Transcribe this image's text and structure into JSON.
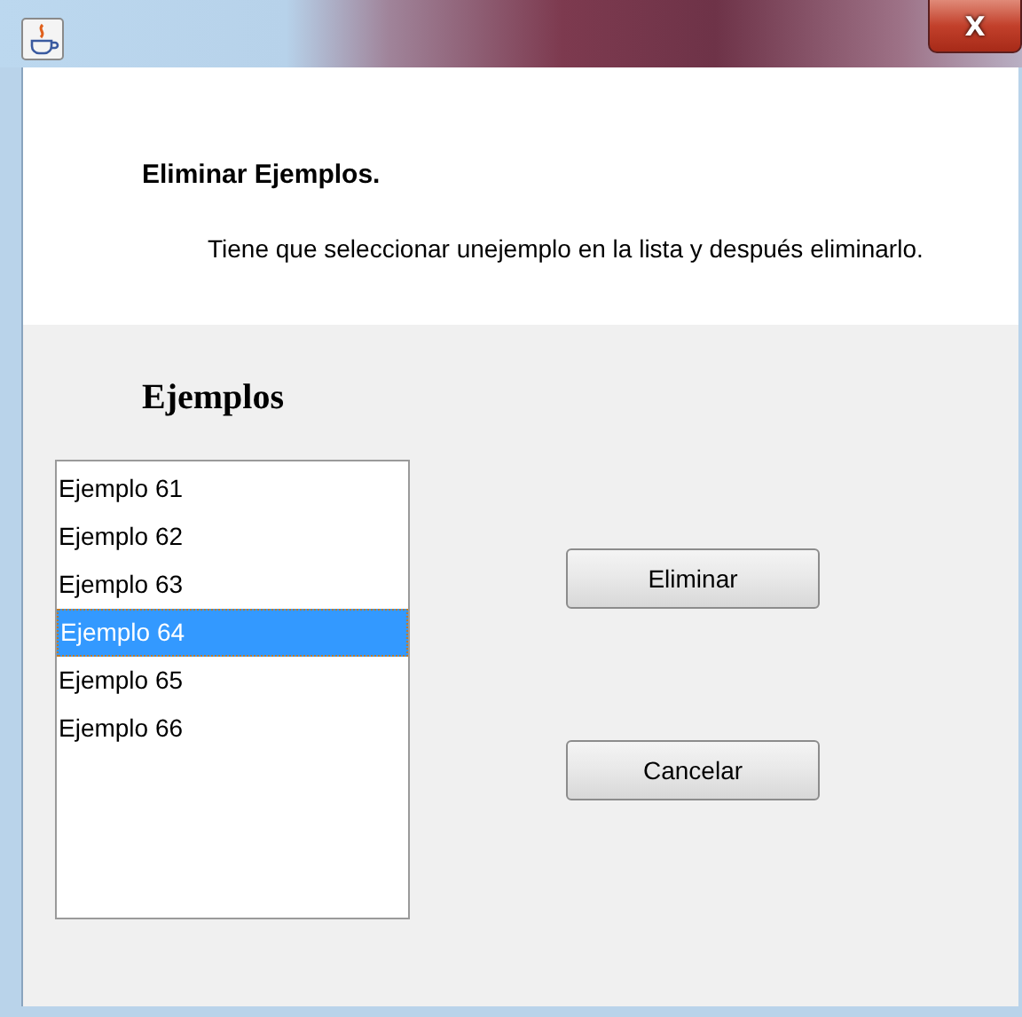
{
  "window": {
    "close": "X"
  },
  "header": {
    "title": "Eliminar Ejemplos.",
    "description": "Tiene que seleccionar unejemplo en la lista y después eliminarlo."
  },
  "list": {
    "label": "Ejemplos",
    "items": [
      {
        "text": "Ejemplo 61",
        "selected": false
      },
      {
        "text": "Ejemplo 62",
        "selected": false
      },
      {
        "text": "Ejemplo 63",
        "selected": false
      },
      {
        "text": "Ejemplo 64",
        "selected": true
      },
      {
        "text": "Ejemplo 65",
        "selected": false
      },
      {
        "text": "Ejemplo 66",
        "selected": false
      }
    ]
  },
  "buttons": [
    "Eliminar",
    "Cancelar"
  ]
}
